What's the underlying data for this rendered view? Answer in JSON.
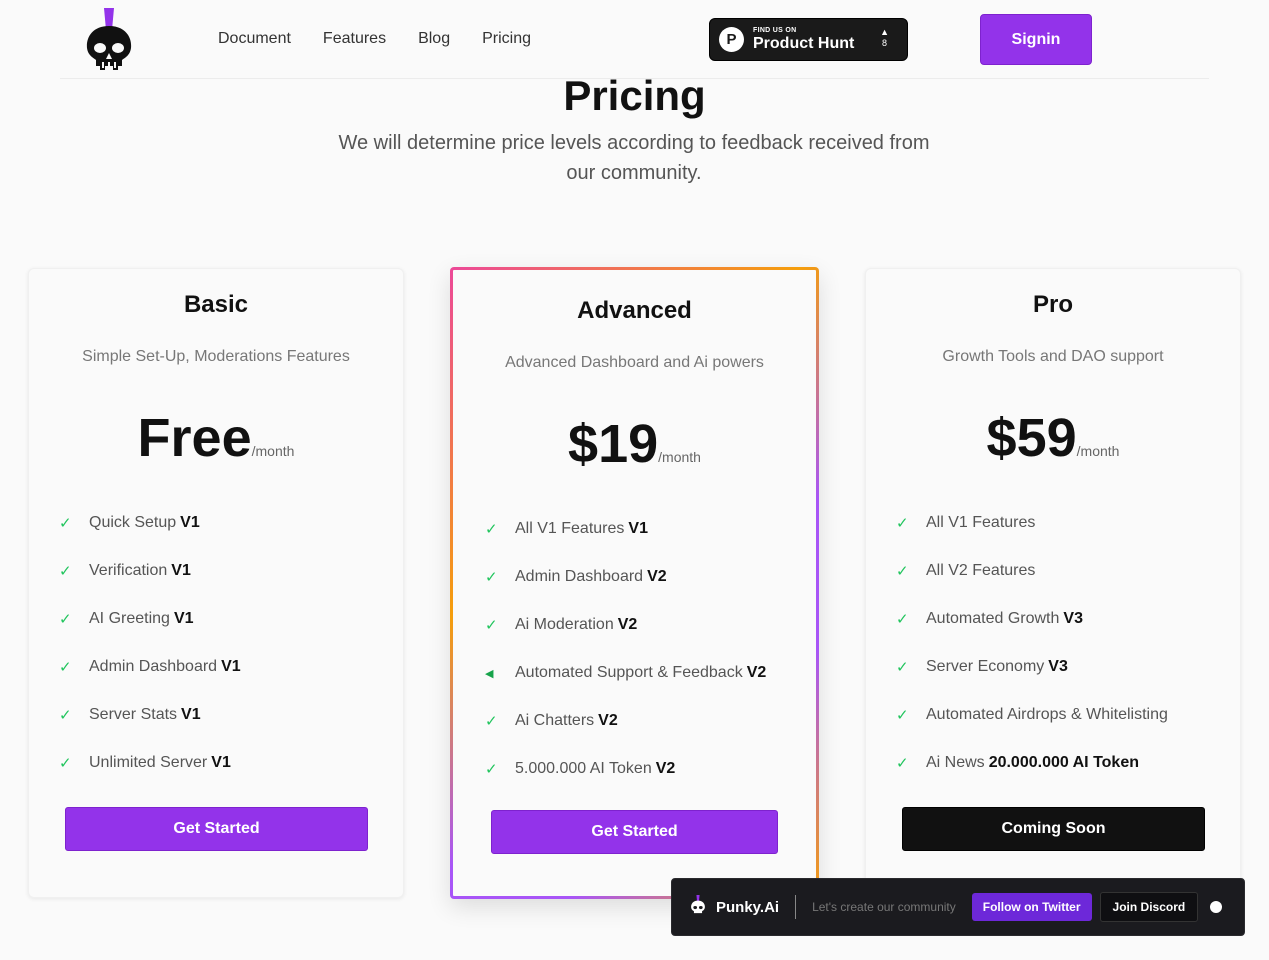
{
  "header": {
    "nav": [
      "Document",
      "Features",
      "Blog",
      "Pricing"
    ],
    "producthunt": {
      "small": "FIND US ON",
      "big": "Product Hunt",
      "vote_count": "8"
    },
    "signin_label": "Signin"
  },
  "hero": {
    "title": "Pricing",
    "subtitle": "We will determine price levels according to feedback received from our community."
  },
  "plans": [
    {
      "name": "Basic",
      "description": "Simple Set-Up, Moderations Features",
      "price": "Free",
      "unit": "/month",
      "features": [
        {
          "text": "Quick Setup",
          "strong": "V1"
        },
        {
          "text": "Verification",
          "strong": "V1"
        },
        {
          "text": "AI Greeting",
          "strong": "V1"
        },
        {
          "text": "Admin Dashboard",
          "strong": "V1"
        },
        {
          "text": "Server Stats",
          "strong": "V1"
        },
        {
          "text": "Unlimited Server",
          "strong": "V1"
        }
      ],
      "cta": "Get Started"
    },
    {
      "name": "Advanced",
      "description": "Advanced Dashboard and Ai powers",
      "price": "$19",
      "unit": "/month",
      "features": [
        {
          "text": "All V1 Features",
          "strong": "V1"
        },
        {
          "text": "Admin Dashboard",
          "strong": "V2"
        },
        {
          "text": "Ai Moderation",
          "strong": "V2"
        },
        {
          "text": "Automated Support & Feedback",
          "strong": "V2"
        },
        {
          "text": "Ai Chatters",
          "strong": "V2"
        },
        {
          "text": "5.000.000 AI Token",
          "strong": "V2"
        }
      ],
      "cta": "Get Started"
    },
    {
      "name": "Pro",
      "description": "Growth Tools and DAO support",
      "price": "$59",
      "unit": "/month",
      "features": [
        {
          "text": "All V1 Features",
          "strong": ""
        },
        {
          "text": "All V2 Features",
          "strong": ""
        },
        {
          "text": "Automated Growth",
          "strong": "V3"
        },
        {
          "text": "Server Economy",
          "strong": "V3"
        },
        {
          "text": "Automated Airdrops & Whitelisting",
          "strong": ""
        },
        {
          "text": "Ai News",
          "strong": "20.000.000 AI Token"
        }
      ],
      "cta": "Coming Soon"
    }
  ],
  "community_bar": {
    "brand": "Punky.Ai",
    "tagline": "Let's create our community",
    "twitter_label": "Follow on Twitter",
    "discord_label": "Join Discord"
  },
  "colors": {
    "accent": "#9333ea",
    "check": "#22c55e",
    "dark_button": "#111111"
  },
  "icons": {
    "logo": "punk-skull-icon",
    "check": "check-icon",
    "producthunt": "producthunt-icon"
  }
}
